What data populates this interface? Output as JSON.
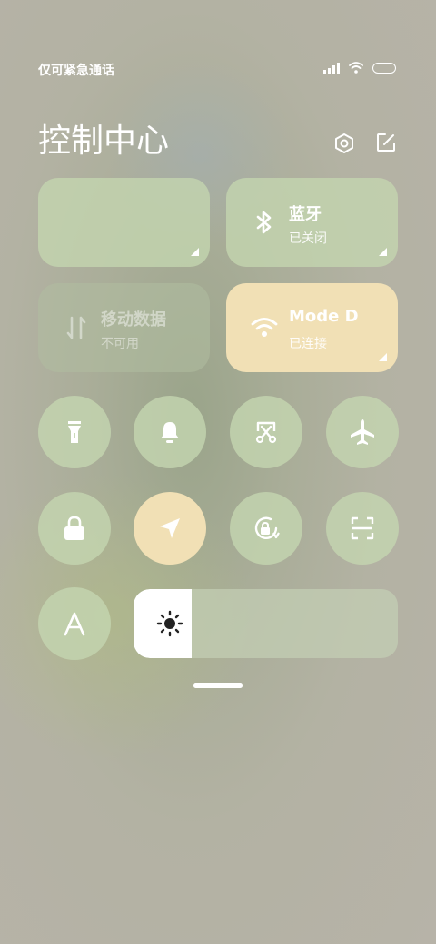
{
  "status_bar": {
    "carrier_text": "仅可紧急通话"
  },
  "header": {
    "title": "控制中心"
  },
  "tiles": {
    "bluetooth": {
      "title": "蓝牙",
      "status": "已关闭"
    },
    "mobile_data": {
      "title": "移动数据",
      "status": "不可用"
    },
    "wifi": {
      "title": "Mode D",
      "status": "已连接"
    }
  },
  "quick_toggles": [
    {
      "name": "flashlight",
      "active": false
    },
    {
      "name": "ringer",
      "active": false
    },
    {
      "name": "screenshot",
      "active": false
    },
    {
      "name": "airplane-mode",
      "active": false
    },
    {
      "name": "lock-screen",
      "active": false
    },
    {
      "name": "location",
      "active": true
    },
    {
      "name": "rotation-lock",
      "active": false
    },
    {
      "name": "scanner",
      "active": false
    },
    {
      "name": "reading-mode",
      "active": false
    }
  ],
  "brightness": {
    "level": 0.22
  },
  "colors": {
    "tile_green": "#c4d6b0",
    "tile_active": "#f1e0b5"
  }
}
